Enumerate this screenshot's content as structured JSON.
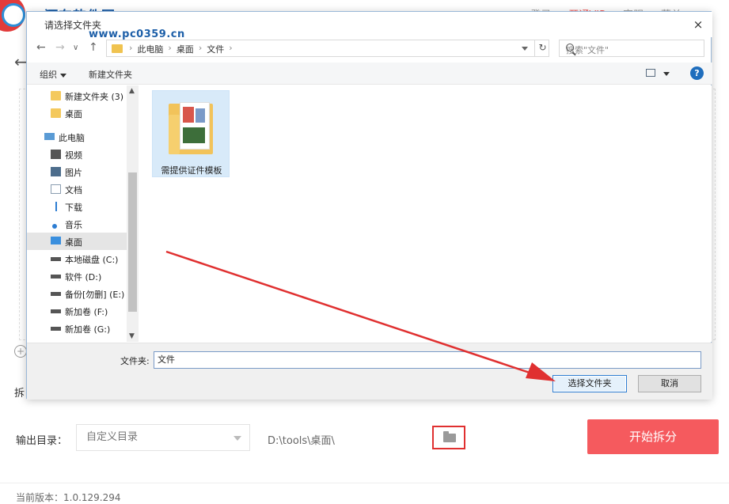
{
  "app": {
    "title": "嗨格式PDF转换器",
    "watermark_logo": "河东软件园",
    "watermark_url": "www.pc0359.cn",
    "top_links": [
      "登录",
      "开通VIP",
      "客服",
      "菜单"
    ],
    "split_label": "拆",
    "output_label": "输出目录：",
    "output_select": "自定义目录",
    "output_path": "D:\\tools\\桌面\\",
    "start_button": "开始拆分",
    "version": "当前版本：1.0.129.294"
  },
  "dialog": {
    "title": "请选择文件夹",
    "close": "×",
    "breadcrumbs": [
      "此电脑",
      "桌面",
      "文件"
    ],
    "search_placeholder": "搜索\"文件\"",
    "toolbar": {
      "organize": "组织",
      "new_folder": "新建文件夹",
      "help": "?"
    },
    "tree": [
      {
        "label": "新建文件夹 (3)",
        "icon": "folder-icon"
      },
      {
        "label": "桌面",
        "icon": "folder-icon"
      },
      {
        "label": "此电脑",
        "icon": "pc-icon"
      },
      {
        "label": "视频",
        "icon": "video-icon"
      },
      {
        "label": "图片",
        "icon": "picture-icon"
      },
      {
        "label": "文档",
        "icon": "document-icon"
      },
      {
        "label": "下载",
        "icon": "download-icon"
      },
      {
        "label": "音乐",
        "icon": "music-icon"
      },
      {
        "label": "桌面",
        "icon": "desktop-icon",
        "selected": true
      },
      {
        "label": "本地磁盘 (C:)",
        "icon": "drive-icon"
      },
      {
        "label": "软件 (D:)",
        "icon": "drive-icon"
      },
      {
        "label": "备份[勿删] (E:)",
        "icon": "drive-icon"
      },
      {
        "label": "新加卷 (F:)",
        "icon": "drive-icon"
      },
      {
        "label": "新加卷 (G:)",
        "icon": "drive-icon"
      }
    ],
    "files": [
      {
        "name": "需提供证件模板"
      }
    ],
    "filename_label": "文件夹:",
    "filename_value": "文件",
    "select_button": "选择文件夹",
    "cancel_button": "取消"
  },
  "colors": {
    "accent": "#f55a5e",
    "dialog_border": "#9ab8d8",
    "annotation": "#e03030"
  }
}
